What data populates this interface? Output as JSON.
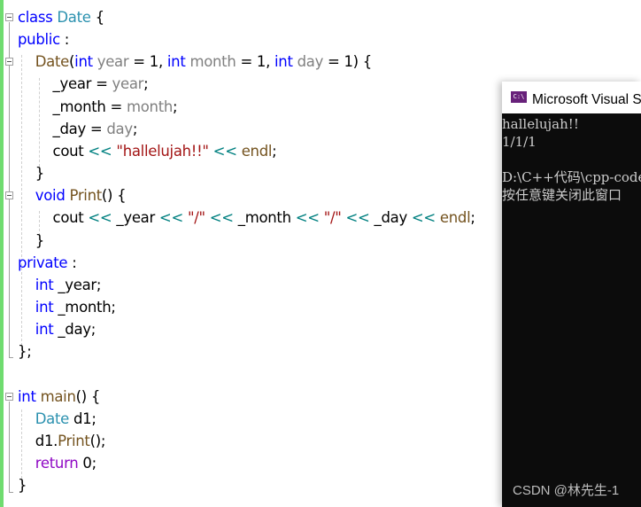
{
  "editor": {
    "lines": [
      [
        {
          "t": "class ",
          "c": "kw"
        },
        {
          "t": "Date",
          "c": "type"
        },
        {
          "t": " {",
          "c": ""
        }
      ],
      [
        {
          "t": "public",
          "c": "kw"
        },
        {
          "t": " :",
          "c": ""
        }
      ],
      [
        {
          "t": "    Date",
          "c": "fn"
        },
        {
          "t": "(",
          "c": ""
        },
        {
          "t": "int",
          "c": "kw"
        },
        {
          "t": " year",
          "c": "param"
        },
        {
          "t": " = 1, ",
          "c": ""
        },
        {
          "t": "int",
          "c": "kw"
        },
        {
          "t": " month",
          "c": "param"
        },
        {
          "t": " = 1, ",
          "c": ""
        },
        {
          "t": "int",
          "c": "kw"
        },
        {
          "t": " day",
          "c": "param"
        },
        {
          "t": " = 1) {",
          "c": ""
        }
      ],
      [
        {
          "t": "        _year = ",
          "c": ""
        },
        {
          "t": "year",
          "c": "param"
        },
        {
          "t": ";",
          "c": ""
        }
      ],
      [
        {
          "t": "        _month = ",
          "c": ""
        },
        {
          "t": "month",
          "c": "param"
        },
        {
          "t": ";",
          "c": ""
        }
      ],
      [
        {
          "t": "        _day = ",
          "c": ""
        },
        {
          "t": "day",
          "c": "param"
        },
        {
          "t": ";",
          "c": ""
        }
      ],
      [
        {
          "t": "        cout ",
          "c": ""
        },
        {
          "t": "<<",
          "c": "op"
        },
        {
          "t": " ",
          "c": ""
        },
        {
          "t": "\"hallelujah!!\"",
          "c": "str"
        },
        {
          "t": " ",
          "c": ""
        },
        {
          "t": "<<",
          "c": "op"
        },
        {
          "t": " ",
          "c": ""
        },
        {
          "t": "endl",
          "c": "fn"
        },
        {
          "t": ";",
          "c": ""
        }
      ],
      [
        {
          "t": "    }",
          "c": ""
        }
      ],
      [
        {
          "t": "    ",
          "c": ""
        },
        {
          "t": "void",
          "c": "kw"
        },
        {
          "t": " ",
          "c": ""
        },
        {
          "t": "Print",
          "c": "fn"
        },
        {
          "t": "() {",
          "c": ""
        }
      ],
      [
        {
          "t": "        cout ",
          "c": ""
        },
        {
          "t": "<<",
          "c": "op"
        },
        {
          "t": " _year ",
          "c": ""
        },
        {
          "t": "<<",
          "c": "op"
        },
        {
          "t": " ",
          "c": ""
        },
        {
          "t": "\"/\"",
          "c": "str"
        },
        {
          "t": " ",
          "c": ""
        },
        {
          "t": "<<",
          "c": "op"
        },
        {
          "t": " _month ",
          "c": ""
        },
        {
          "t": "<<",
          "c": "op"
        },
        {
          "t": " ",
          "c": ""
        },
        {
          "t": "\"/\"",
          "c": "str"
        },
        {
          "t": " ",
          "c": ""
        },
        {
          "t": "<<",
          "c": "op"
        },
        {
          "t": " _day ",
          "c": ""
        },
        {
          "t": "<<",
          "c": "op"
        },
        {
          "t": " ",
          "c": ""
        },
        {
          "t": "endl",
          "c": "fn"
        },
        {
          "t": ";",
          "c": ""
        }
      ],
      [
        {
          "t": "    }",
          "c": ""
        }
      ],
      [
        {
          "t": "private",
          "c": "kw"
        },
        {
          "t": " :",
          "c": ""
        }
      ],
      [
        {
          "t": "    ",
          "c": ""
        },
        {
          "t": "int",
          "c": "kw"
        },
        {
          "t": " _year;",
          "c": ""
        }
      ],
      [
        {
          "t": "    ",
          "c": ""
        },
        {
          "t": "int",
          "c": "kw"
        },
        {
          "t": " _month;",
          "c": ""
        }
      ],
      [
        {
          "t": "    ",
          "c": ""
        },
        {
          "t": "int",
          "c": "kw"
        },
        {
          "t": " _day;",
          "c": ""
        }
      ],
      [
        {
          "t": "};",
          "c": ""
        }
      ],
      [],
      [
        {
          "t": "int",
          "c": "kw"
        },
        {
          "t": " ",
          "c": ""
        },
        {
          "t": "main",
          "c": "fn"
        },
        {
          "t": "() {",
          "c": ""
        }
      ],
      [
        {
          "t": "    ",
          "c": ""
        },
        {
          "t": "Date",
          "c": "type"
        },
        {
          "t": " d1;",
          "c": ""
        }
      ],
      [
        {
          "t": "    d1.",
          "c": ""
        },
        {
          "t": "Print",
          "c": "fn"
        },
        {
          "t": "();",
          "c": ""
        }
      ],
      [
        {
          "t": "    ",
          "c": ""
        },
        {
          "t": "return",
          "c": "ret"
        },
        {
          "t": " 0;",
          "c": ""
        }
      ],
      [
        {
          "t": "}",
          "c": ""
        }
      ]
    ]
  },
  "console": {
    "icon_text": "C:\\",
    "title": "Microsoft Visual Studio 调试控制台",
    "output": [
      "hallelujah!!",
      "1/1/1",
      "",
      "D:\\C++代码\\cpp-code",
      "按任意键关闭此窗口"
    ]
  },
  "watermark": "CSDN @林先生-1"
}
